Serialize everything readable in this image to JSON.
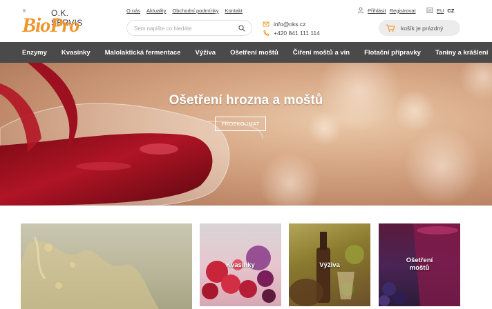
{
  "brand": {
    "name_top": "O.K. SERVIS",
    "name_main": "BioPro"
  },
  "top_links": [
    "O nás",
    "Aktuality",
    "Obchodní podmínky",
    "Kontakt"
  ],
  "search": {
    "placeholder": "Sem napište co hledáte"
  },
  "contact": {
    "email": "info@oks.cz",
    "phone": "+420 841 111 114"
  },
  "account": {
    "login": "Přihlásit",
    "register": "Registrovat"
  },
  "language": {
    "eu": "EU",
    "cz": "CZ"
  },
  "cart": {
    "label": "košík je prázdný"
  },
  "nav": [
    "Enzymy",
    "Kvasinky",
    "Malolaktická fermentace",
    "Výživa",
    "Ošetření moštů",
    "Čiření moštů a vín",
    "Flotační přípravky",
    "Taniny a krášlení"
  ],
  "hero": {
    "title": "Ošetření hrozna a moštů",
    "button": "PROZKOUMAT"
  },
  "tiles": [
    {
      "label": ""
    },
    {
      "label": "Kvasinky"
    },
    {
      "label": "Výživa"
    },
    {
      "label_line1": "Ošetření",
      "label_line2": "moštů"
    }
  ],
  "colors": {
    "accent": "#f0952a",
    "nav_bg": "#4a4a4a"
  },
  "icons": {
    "search": "search-icon",
    "email": "email-icon",
    "phone": "phone-icon",
    "user": "user-icon",
    "language": "language-icon",
    "cart": "cart-icon"
  }
}
